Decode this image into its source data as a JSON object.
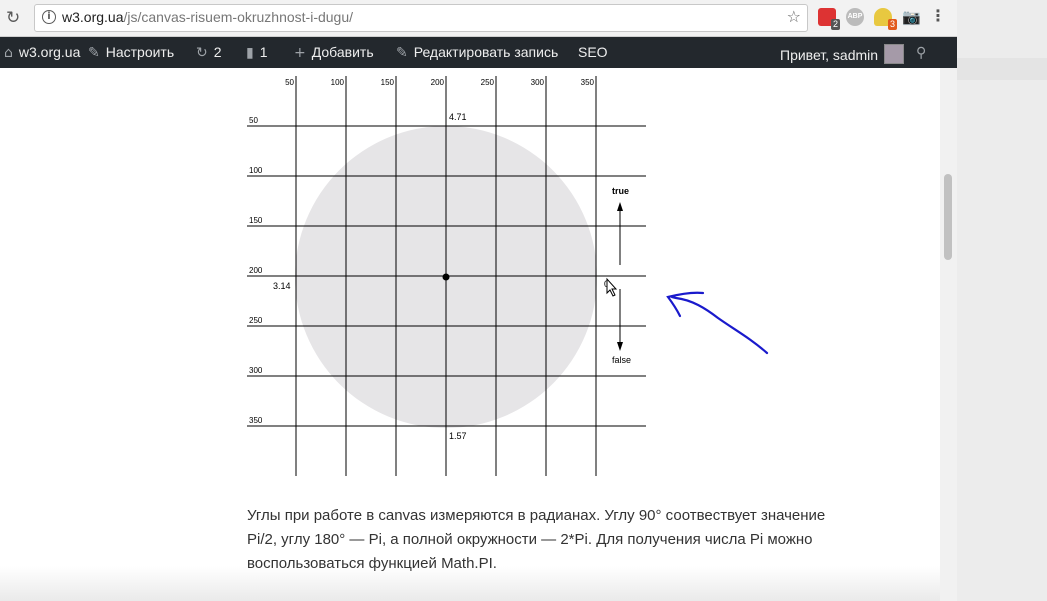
{
  "browser": {
    "url_host": "w3.org.ua",
    "url_path": "/js/canvas-risuem-okruzhnost-i-dugu/",
    "extensions": {
      "calendar_badge": "2",
      "adblock_label": "ABP",
      "bulb_badge": "3"
    }
  },
  "adminbar": {
    "site": "w3.org.ua",
    "customize": "Настроить",
    "updates_count": "2",
    "comments_count": "1",
    "add_new": "Добавить",
    "edit_post": "Редактировать запись",
    "seo": "SEO",
    "greeting": "Привет, sadmin"
  },
  "figure": {
    "x_ticks": [
      "50",
      "100",
      "150",
      "200",
      "250",
      "300",
      "350"
    ],
    "y_ticks": [
      "50",
      "100",
      "150",
      "200",
      "250",
      "300",
      "350"
    ],
    "angle_top": "4.71",
    "angle_left": "3.14",
    "angle_right": "0",
    "angle_bottom": "1.57",
    "label_true": "true",
    "label_false": "false",
    "circle_fill": "#e6e5e7",
    "annotation_color": "#1a1acc"
  },
  "article": {
    "paragraph": "Углы при работе в canvas измеряются в радианах. Углу 90° соотвествует значение Pi/2, углу 180° — Pi, а полной окружности — 2*Pi. Для получения числа Pi можно воспользоваться функцией Math.PI."
  }
}
